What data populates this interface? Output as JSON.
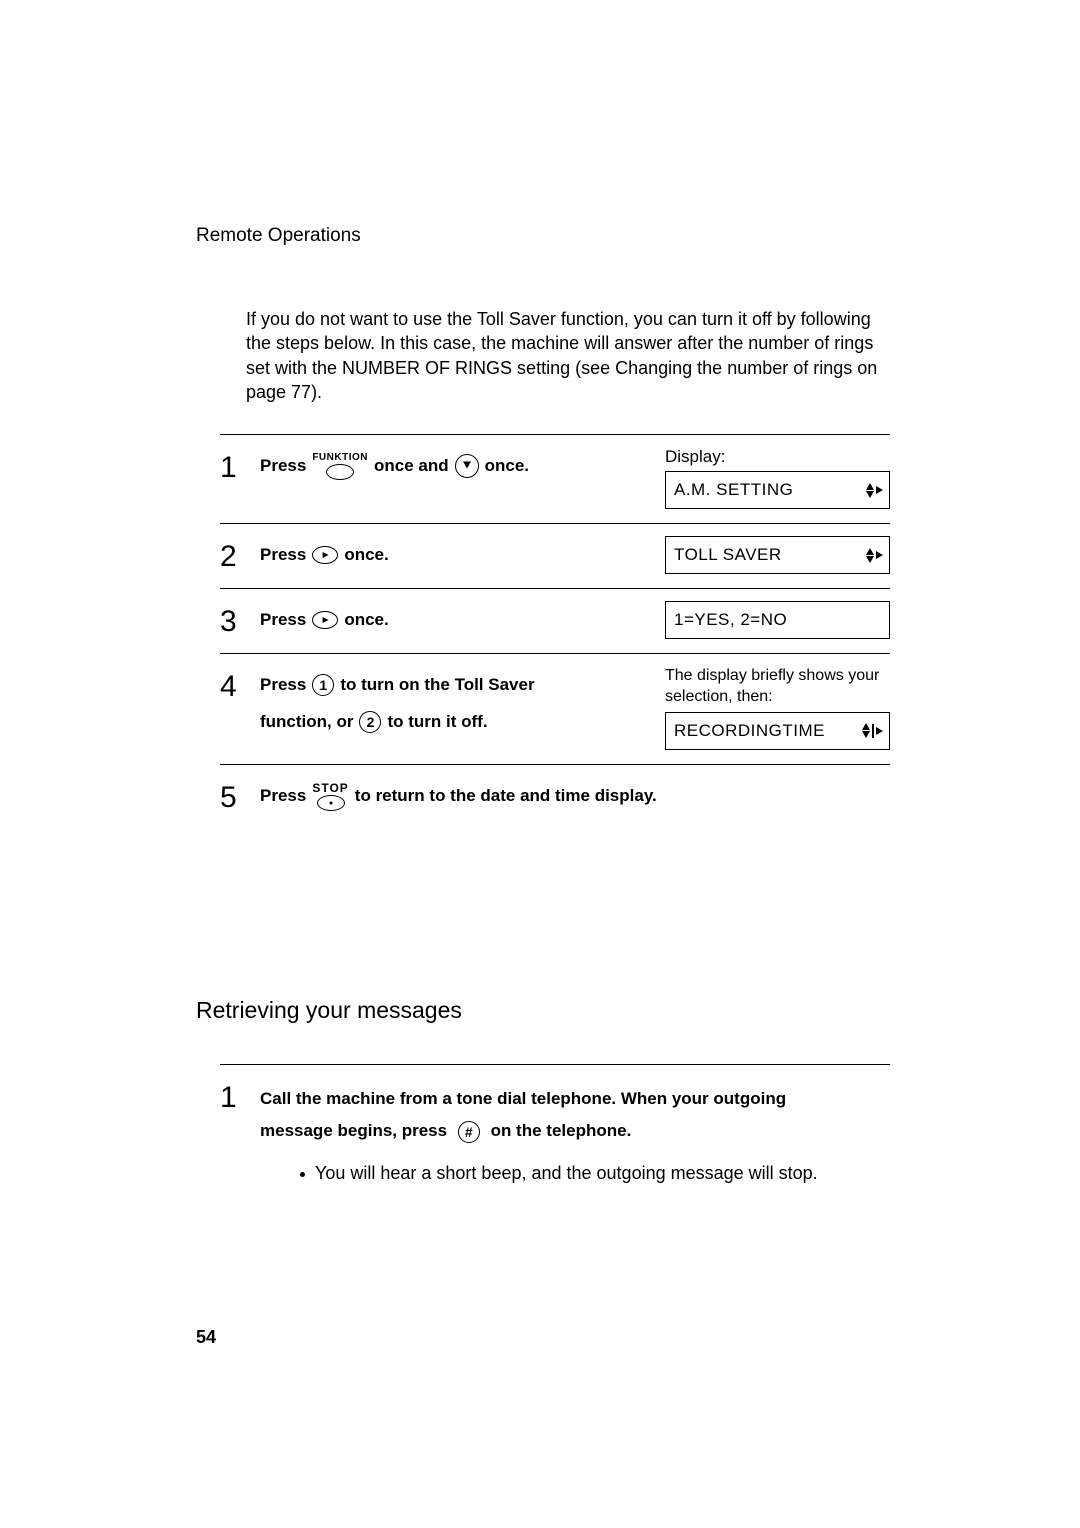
{
  "header": {
    "running_head": "Remote Operations"
  },
  "intro": "If you do not want to use the Toll Saver function, you can turn it off by following the steps below. In this case, the machine will answer after the number of rings set with the NUMBER OF RINGS setting (see Changing the number of rings on page 77).",
  "icons": {
    "funktion_label": "FUNKTION",
    "stop_label": "STOP",
    "key1": "1",
    "key2": "2",
    "hash": "#"
  },
  "display_word": "Display:",
  "steps": [
    {
      "num": "1",
      "parts": {
        "a": "Press",
        "b": "once and",
        "c": "once."
      },
      "display": "A.M. SETTING"
    },
    {
      "num": "2",
      "parts": {
        "a": "Press",
        "b": "once."
      },
      "display": "TOLL SAVER"
    },
    {
      "num": "3",
      "parts": {
        "a": "Press",
        "b": "once."
      },
      "display": "1=YES, 2=NO"
    },
    {
      "num": "4",
      "parts": {
        "a": "Press",
        "b": "to turn on the Toll Saver",
        "c": "function, or",
        "d": "to turn it off."
      },
      "note": "The display briefly shows your selection, then:",
      "display": "RECORDINGTIME"
    },
    {
      "num": "5",
      "parts": {
        "a": "Press",
        "b": "to return to the date and time display."
      }
    }
  ],
  "section2": {
    "title": "Retrieving your messages",
    "step_num": "1",
    "line_a": "Call the machine from a tone dial telephone. When your outgoing",
    "line_b_pre": "message begins, press",
    "line_b_post": "on the telephone.",
    "bullet": "You will hear a short beep, and the outgoing message will stop."
  },
  "page_number": "54"
}
